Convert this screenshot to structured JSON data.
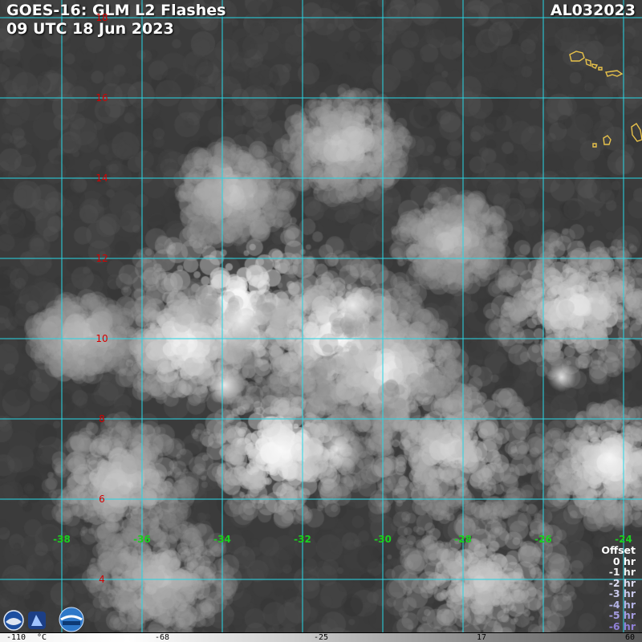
{
  "header": {
    "title_line1": "GOES-16: GLM L2 Flashes",
    "title_line2": "09 UTC 18 Jun 2023",
    "storm_id": "AL032023"
  },
  "grid": {
    "lat_labels": [
      "18",
      "16",
      "14",
      "12",
      "10",
      "8",
      "6",
      "4"
    ],
    "lon_labels": [
      "-38",
      "-36",
      "-34",
      "-32",
      "-30",
      "-28",
      "-26",
      "-24"
    ],
    "line_color": "#27d7e6",
    "lat_label_color": "#d40000",
    "lon_label_color": "#19d11e"
  },
  "legend": {
    "title": "Offset",
    "rows": [
      {
        "label": "0 hr",
        "color": "#ffffff"
      },
      {
        "label": "-1 hr",
        "color": "#f0f0f0"
      },
      {
        "label": "-2 hr",
        "color": "#dcdcf0"
      },
      {
        "label": "-3 hr",
        "color": "#c8c8ea"
      },
      {
        "label": "-4 hr",
        "color": "#b4b4e6"
      },
      {
        "label": "-5 hr",
        "color": "#a49ce0"
      },
      {
        "label": "-6 hr",
        "color": "#9080d8"
      }
    ]
  },
  "colorbar": {
    "unit": "°C",
    "ticks": [
      "-110",
      "-68",
      "-25",
      "17",
      "60"
    ]
  },
  "coastline_color": "#e8c24a",
  "icons": [
    "noaa-logo",
    "nesdis-logo",
    "ramm-logo"
  ]
}
